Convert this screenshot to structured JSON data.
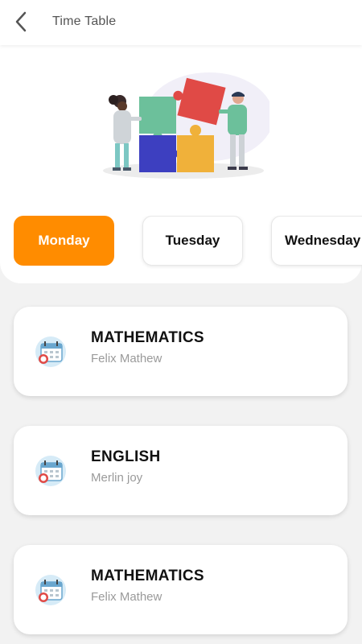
{
  "header": {
    "title": "Time Table"
  },
  "days": [
    {
      "label": "Monday",
      "active": true
    },
    {
      "label": "Tuesday",
      "active": false
    },
    {
      "label": "Wednesday",
      "active": false
    }
  ],
  "classes": [
    {
      "subject": "MATHEMATICS",
      "teacher": "Felix Mathew"
    },
    {
      "subject": "ENGLISH",
      "teacher": "Merlin joy"
    },
    {
      "subject": "MATHEMATICS",
      "teacher": "Felix Mathew"
    }
  ],
  "colors": {
    "accent": "#ff8c00"
  }
}
